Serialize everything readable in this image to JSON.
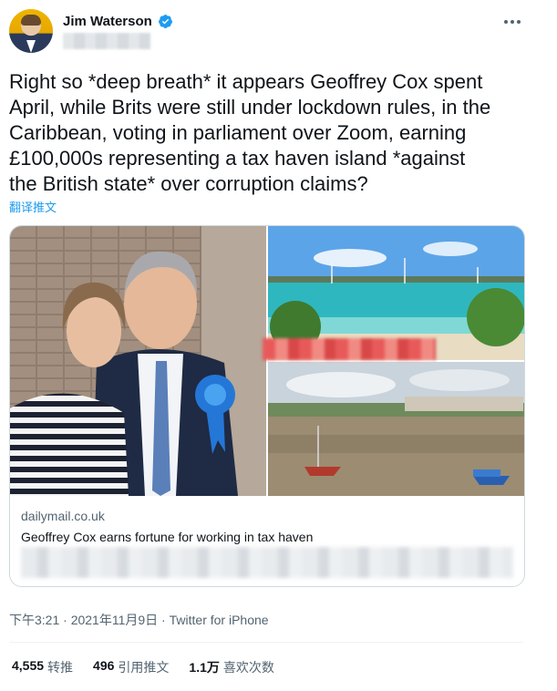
{
  "author": {
    "display_name": "Jim Waterson",
    "verified_icon": "verified-badge-icon",
    "avatar_icon": "profile-avatar"
  },
  "tweet": {
    "text": "Right so *deep breath* it appears Geoffrey Cox spent\nApril, while Brits were still under lockdown rules, in the\nCaribbean, voting in parliament over Zoom, earning\n£100,000s representing a tax haven island *against\nthe British state* over corruption claims?",
    "translate_label": "翻译推文"
  },
  "card": {
    "domain": "dailymail.co.uk",
    "title": "Geoffrey Cox earns fortune for working in tax haven"
  },
  "meta": {
    "time": "下午3:21",
    "separator": " · ",
    "date": "2021年11月9日",
    "source": "Twitter for iPhone"
  },
  "stats": {
    "retweets_count": "4,555",
    "retweets_label": "转推",
    "quotes_count": "496",
    "quotes_label": "引用推文",
    "likes_count": "1.1万",
    "likes_label": "喜欢次数"
  },
  "colors": {
    "accent": "#1d9bf0",
    "text": "#0f1419",
    "secondary": "#536471"
  }
}
